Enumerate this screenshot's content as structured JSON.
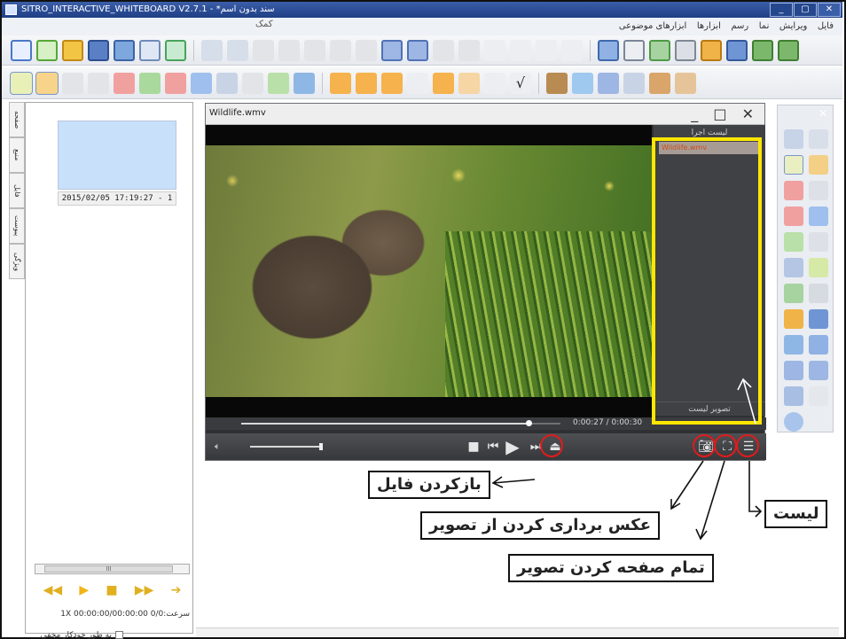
{
  "window": {
    "title": "SITRO_INTERACTIVE_WHITEBOARD V2.7.1 - *سند بدون اسم",
    "controls": [
      "_",
      "▢",
      "✕"
    ]
  },
  "menubar": {
    "items": [
      "فایل",
      "ویرایش",
      "نما",
      "رسم",
      "ابزارها",
      "ابزارهای موضوعی"
    ],
    "help": "کمک"
  },
  "left_tabs": [
    "صفحه",
    "منبع",
    "فایل",
    "پیوست",
    "ویژگی"
  ],
  "left_panel": {
    "thumbnail_label": "2015/02/05 17:19:27 - 1",
    "scroll_label": "III",
    "status": "سرعت:1X   00:00:00/00:00:00   0/0",
    "autohide": "به طور خودکار مخفی شود"
  },
  "player": {
    "file_name": "Wildlife.wmv",
    "time": "0:00:27 / 0:00:30",
    "progress": 0.9,
    "playlist_header": "لیست اجرا",
    "playlist_items": [
      "Wildlife.wmv"
    ],
    "playlist_footer": "تصویر لیست"
  },
  "annotations": {
    "open_file": "بازکردن فایل",
    "snapshot": "عکس برداری کردن از تصویر",
    "fullscreen": "تمام صفحه کردن تصویر",
    "list": "لیست"
  },
  "colors": {
    "highlight_box": "#ffe600",
    "circle": "#e11b1b"
  }
}
